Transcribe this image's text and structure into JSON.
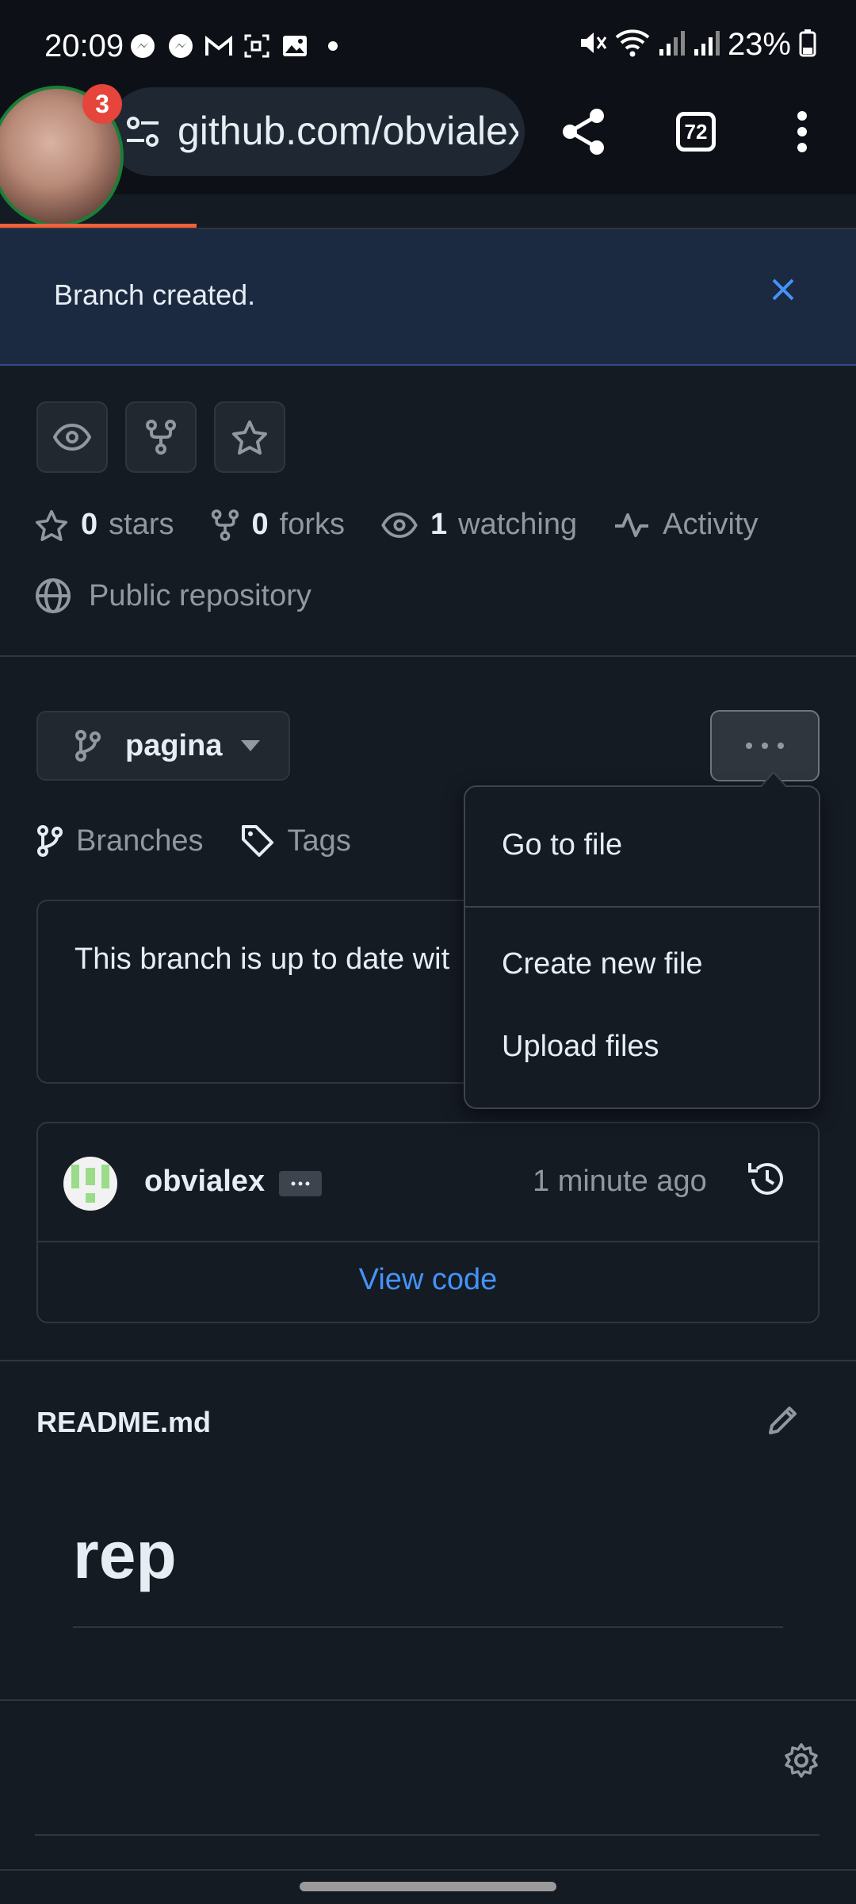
{
  "status_bar": {
    "time": "20:09",
    "battery": "23%",
    "left_icons": [
      "messenger-icon",
      "messenger-icon",
      "gmail-icon",
      "screen-record-icon",
      "gallery-icon",
      "dot-icon"
    ],
    "right_icons": [
      "mute-icon",
      "wifi-icon",
      "signal-icon",
      "signal-icon",
      "battery-icon"
    ]
  },
  "browser": {
    "url": "github.com/obvialex",
    "tab_count": "72",
    "notification_count": "3"
  },
  "flash": {
    "message": "Branch created."
  },
  "repo_meta": {
    "stars_count": "0",
    "stars_label": "stars",
    "forks_count": "0",
    "forks_label": "forks",
    "watching_count": "1",
    "watching_label": "watching",
    "activity_label": "Activity",
    "visibility": "Public repository"
  },
  "branch": {
    "name": "pagina",
    "branches_label": "Branches",
    "tags_label": "Tags",
    "status_text": "This branch is up to date wit"
  },
  "commit": {
    "author": "obvialex",
    "time": "1 minute ago",
    "view_code": "View code"
  },
  "readme": {
    "filename": "README.md",
    "heading": "rep"
  },
  "menu": {
    "items": [
      "Go to file",
      "Create new file",
      "Upload files"
    ]
  },
  "colors": {
    "accent_link": "#4493f8",
    "flash_bg": "#1b2a41",
    "notification_badge": "#e5453b",
    "page_bg": "#151b23"
  }
}
